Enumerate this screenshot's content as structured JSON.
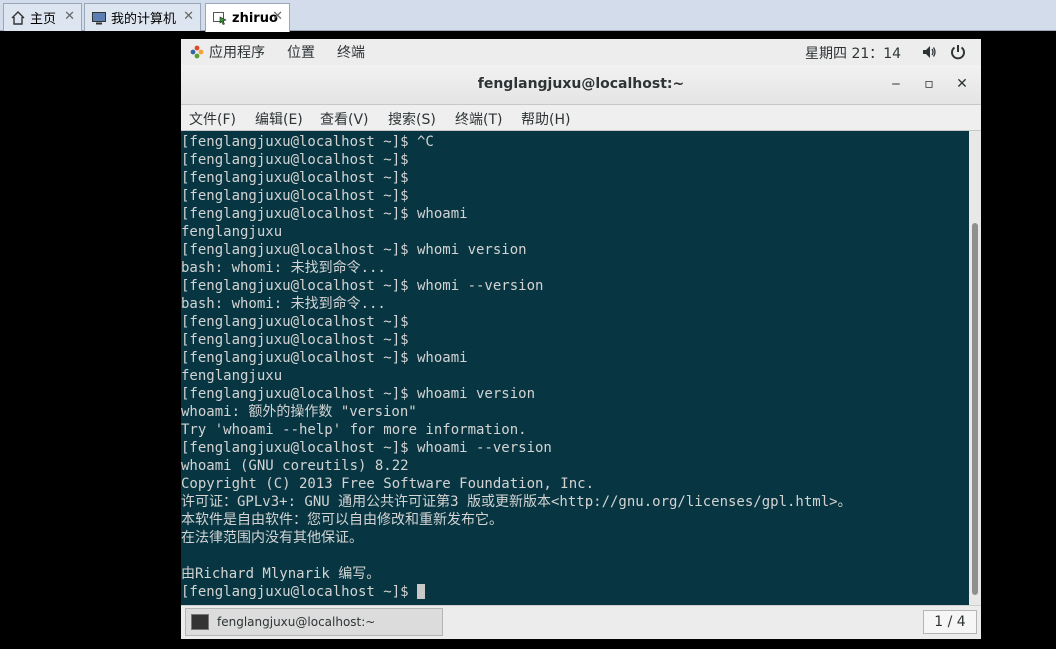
{
  "host_tabs": [
    {
      "label": "主页",
      "icon": "home-icon"
    },
    {
      "label": "我的计算机",
      "icon": "computer-icon"
    },
    {
      "label": "zhiruo",
      "icon": "vm-icon",
      "active": true
    }
  ],
  "host_tab_close": "✕",
  "topbar": {
    "menus": [
      "应用程序",
      "位置",
      "终端"
    ],
    "clock": "星期四 21：14"
  },
  "window": {
    "title": "fenglangjuxu@localhost:~",
    "minimize": "‒",
    "maximize": "▫",
    "close": "✕"
  },
  "menubar": [
    "文件(F)",
    "编辑(E)",
    "查看(V)",
    "搜索(S)",
    "终端(T)",
    "帮助(H)"
  ],
  "terminal": {
    "lines": [
      "[fenglangjuxu@localhost ~]$ ^C",
      "[fenglangjuxu@localhost ~]$",
      "[fenglangjuxu@localhost ~]$",
      "[fenglangjuxu@localhost ~]$",
      "[fenglangjuxu@localhost ~]$ whoami",
      "fenglangjuxu",
      "[fenglangjuxu@localhost ~]$ whomi version",
      "bash: whomi: 未找到命令...",
      "[fenglangjuxu@localhost ~]$ whomi --version",
      "bash: whomi: 未找到命令...",
      "[fenglangjuxu@localhost ~]$",
      "[fenglangjuxu@localhost ~]$",
      "[fenglangjuxu@localhost ~]$ whoami",
      "fenglangjuxu",
      "[fenglangjuxu@localhost ~]$ whoami version",
      "whoami: 额外的操作数 \"version\"",
      "Try 'whoami --help' for more information.",
      "[fenglangjuxu@localhost ~]$ whoami --version",
      "whoami (GNU coreutils) 8.22",
      "Copyright (C) 2013 Free Software Foundation, Inc.",
      "许可证：GPLv3+: GNU 通用公共许可证第3 版或更新版本<http://gnu.org/licenses/gpl.html>。",
      "本软件是自由软件：您可以自由修改和重新发布它。",
      "在法律范围内没有其他保证。",
      "",
      "由Richard Mlynarik 编写。"
    ],
    "prompt": "[fenglangjuxu@localhost ~]$ "
  },
  "taskbar": {
    "task_label": "fenglangjuxu@localhost:~",
    "workspace": "1 / 4"
  }
}
